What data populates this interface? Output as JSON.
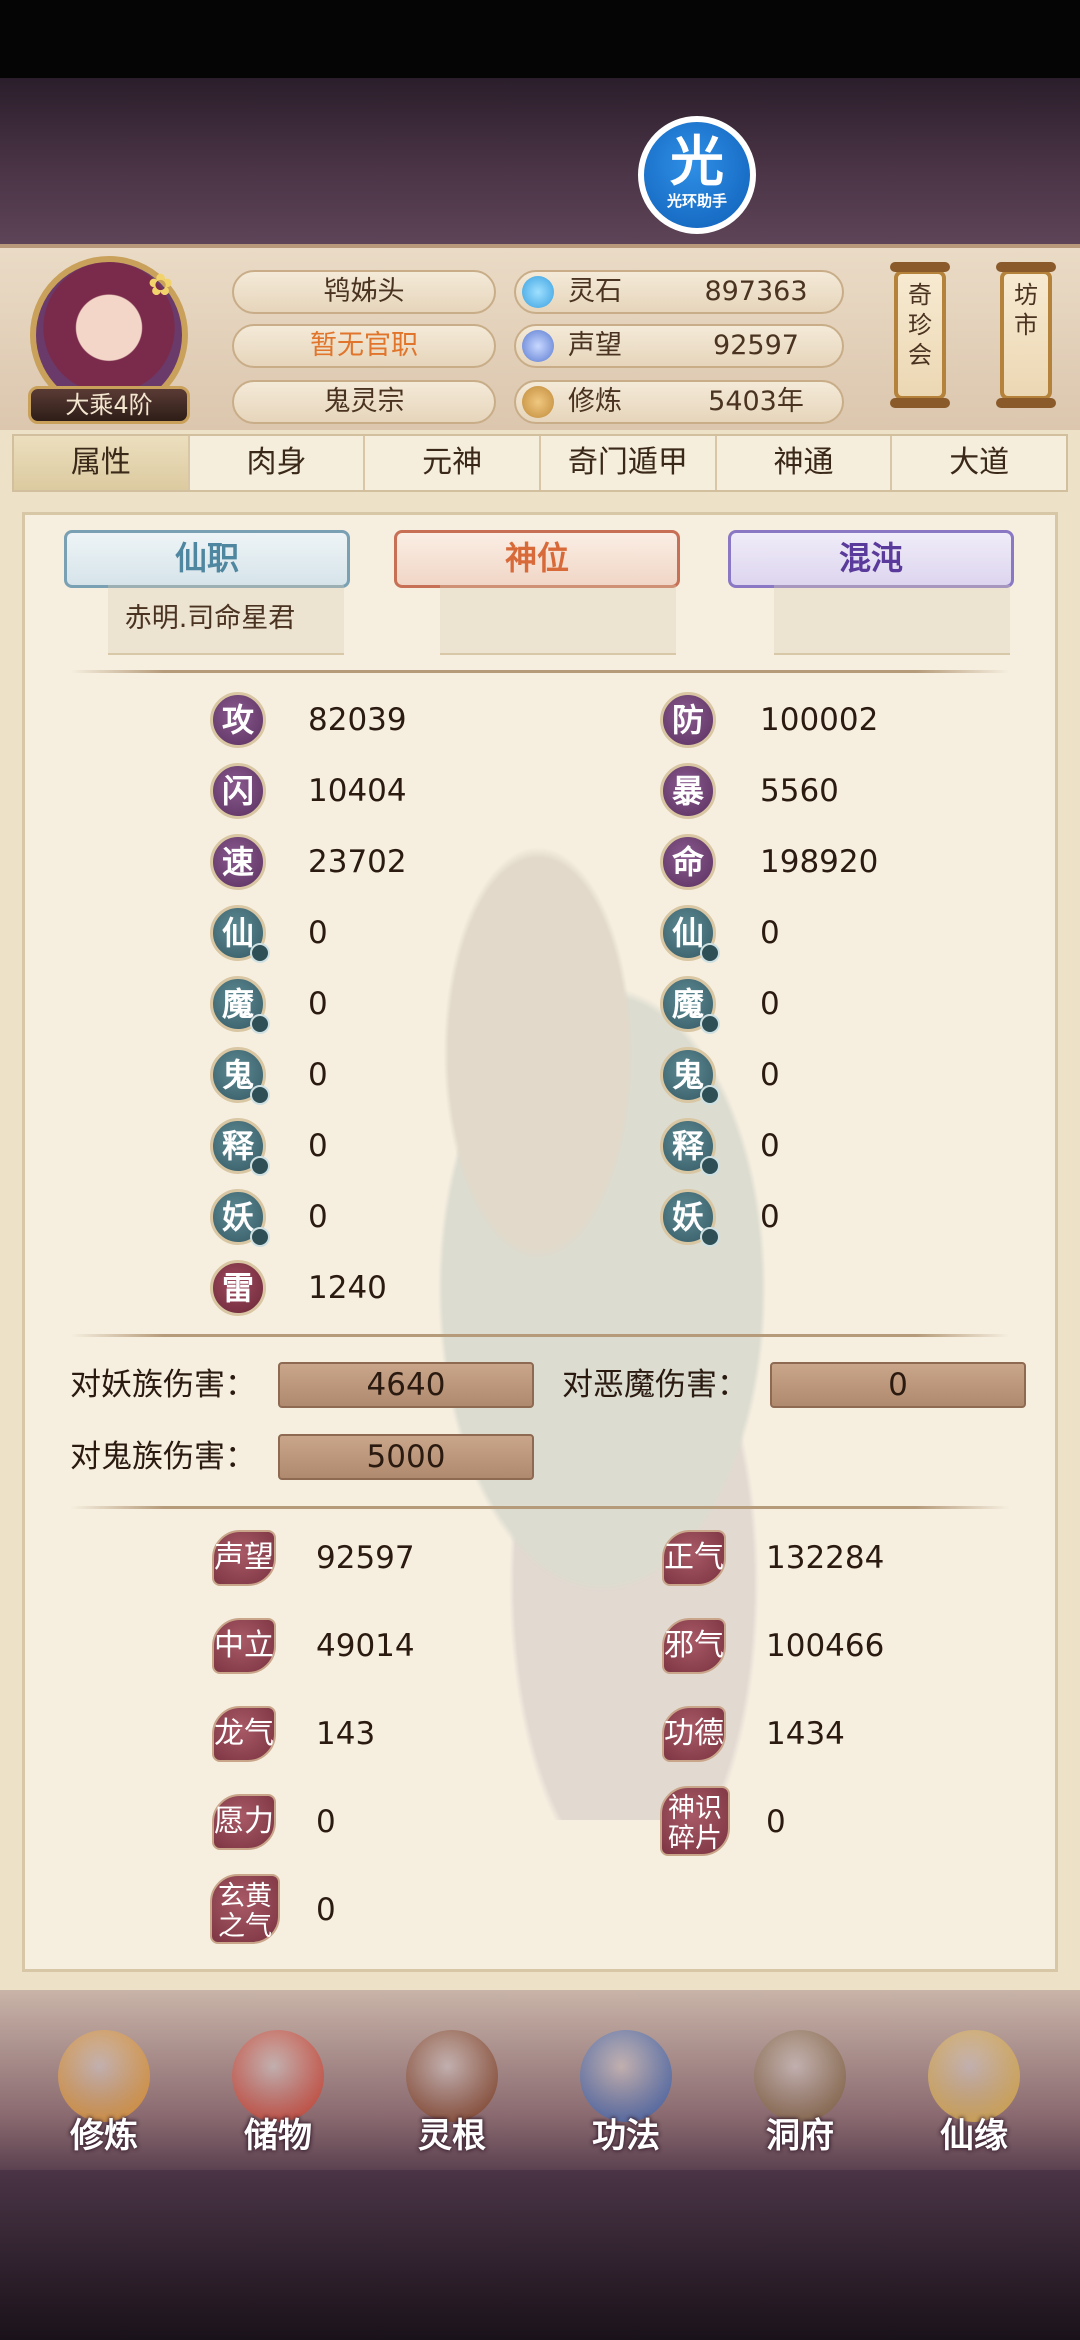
{
  "assistant_badge": {
    "glyph": "光",
    "label": "光环助手"
  },
  "player": {
    "avatar": "avatar-portrait",
    "rank": "大乘4阶",
    "title": "鸨姊头",
    "office": "暂无官职",
    "sect": "鬼灵宗"
  },
  "resources": [
    {
      "icon": "spirit-stone-icon",
      "label": "灵石",
      "value": "897363",
      "color": "#3aa0e0"
    },
    {
      "icon": "prestige-crystal-icon",
      "label": "声望",
      "value": "92597",
      "color": "#5a7ad0"
    },
    {
      "icon": "meditation-icon",
      "label": "修炼",
      "value": "5403年",
      "color": "#c08a3a"
    }
  ],
  "scroll_buttons": {
    "treasure_fair": "奇珍会",
    "market": "坊市"
  },
  "tabs": [
    "属性",
    "肉身",
    "元神",
    "奇门遁甲",
    "神通",
    "大道"
  ],
  "active_tab": "属性",
  "positions": {
    "immortal_post": "仙职",
    "divine_seat": "神位",
    "chaos": "混沌",
    "immortal_post_value": "赤明.司命星君"
  },
  "stats_left": [
    {
      "glyph": "攻",
      "value": "82039",
      "kind": "purple"
    },
    {
      "glyph": "闪",
      "value": "10404",
      "kind": "purple"
    },
    {
      "glyph": "速",
      "value": "23702",
      "kind": "purple"
    },
    {
      "glyph": "仙",
      "value": "0",
      "kind": "teal"
    },
    {
      "glyph": "魔",
      "value": "0",
      "kind": "teal"
    },
    {
      "glyph": "鬼",
      "value": "0",
      "kind": "teal"
    },
    {
      "glyph": "释",
      "value": "0",
      "kind": "teal"
    },
    {
      "glyph": "妖",
      "value": "0",
      "kind": "teal"
    },
    {
      "glyph": "雷",
      "value": "1240",
      "kind": "red"
    }
  ],
  "stats_right": [
    {
      "glyph": "防",
      "value": "100002",
      "kind": "purple"
    },
    {
      "glyph": "暴",
      "value": "5560",
      "kind": "purple"
    },
    {
      "glyph": "命",
      "value": "198920",
      "kind": "purple"
    },
    {
      "glyph": "仙",
      "value": "0",
      "kind": "teal"
    },
    {
      "glyph": "魔",
      "value": "0",
      "kind": "teal"
    },
    {
      "glyph": "鬼",
      "value": "0",
      "kind": "teal"
    },
    {
      "glyph": "释",
      "value": "0",
      "kind": "teal"
    },
    {
      "glyph": "妖",
      "value": "0",
      "kind": "teal"
    }
  ],
  "damage": {
    "vs_demon_tribe_label": "对妖族伤害：",
    "vs_demon_tribe": "4640",
    "vs_evil_demon_label": "对恶魔伤害：",
    "vs_evil_demon": "0",
    "vs_ghost_label": "对鬼族伤害：",
    "vs_ghost": "5000"
  },
  "standing": [
    {
      "label": "声望",
      "value": "92597"
    },
    {
      "label": "正气",
      "value": "132284"
    },
    {
      "label": "中立",
      "value": "49014"
    },
    {
      "label": "邪气",
      "value": "100466"
    },
    {
      "label": "龙气",
      "value": "143"
    },
    {
      "label": "功德",
      "value": "1434"
    },
    {
      "label": "愿力",
      "value": "0"
    },
    {
      "label": "神识碎片",
      "value": "0"
    },
    {
      "label": "玄黄之气",
      "value": "0"
    }
  ],
  "nav": [
    {
      "label": "修炼",
      "icon": "cultivate-icon",
      "color": "#d48a2a"
    },
    {
      "label": "储物",
      "icon": "storage-bag-icon",
      "color": "#c23a2a"
    },
    {
      "label": "灵根",
      "icon": "spirit-root-icon",
      "color": "#7a3a20"
    },
    {
      "label": "功法",
      "icon": "technique-book-icon",
      "color": "#3a5aa0"
    },
    {
      "label": "洞府",
      "icon": "cave-dwelling-icon",
      "color": "#7a5a3a"
    },
    {
      "label": "仙缘",
      "icon": "gourd-icon",
      "color": "#d0a040"
    }
  ]
}
